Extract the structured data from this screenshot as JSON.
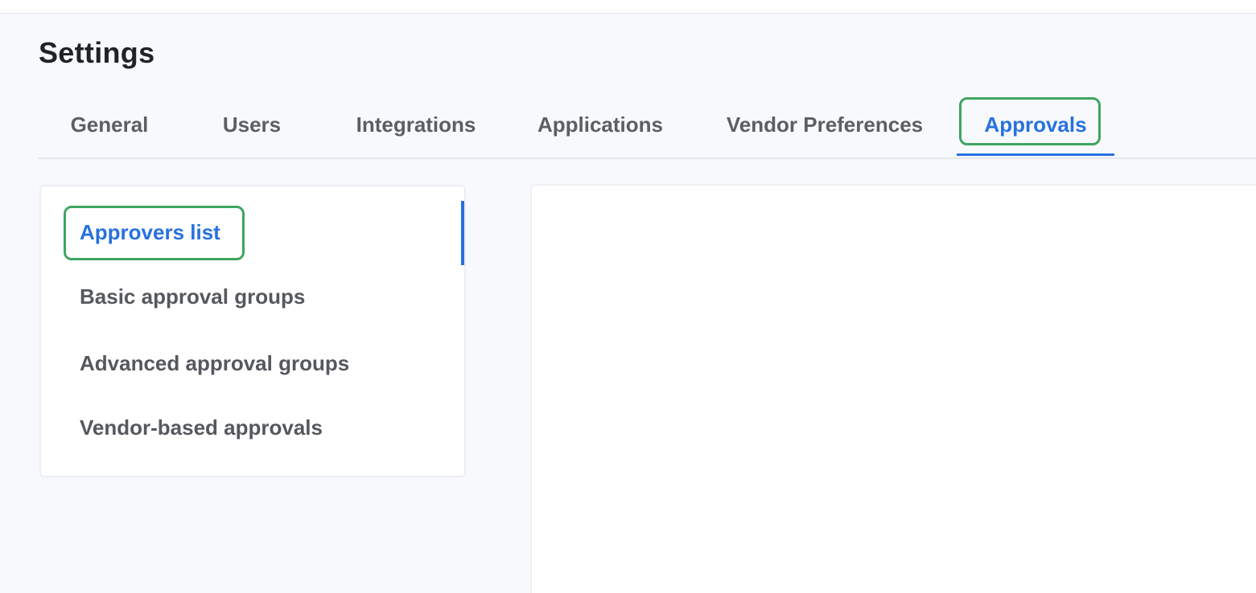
{
  "page": {
    "title": "Settings"
  },
  "tabs": [
    {
      "label": "General",
      "active": false
    },
    {
      "label": "Users",
      "active": false
    },
    {
      "label": "Integrations",
      "active": false
    },
    {
      "label": "Applications",
      "active": false
    },
    {
      "label": "Vendor Preferences",
      "active": false
    },
    {
      "label": "Approvals",
      "active": true
    }
  ],
  "approvals_menu": {
    "items": [
      {
        "label": "Approvers list",
        "active": true
      },
      {
        "label": "Basic approval groups",
        "active": false
      },
      {
        "label": "Advanced approval groups",
        "active": false
      },
      {
        "label": "Vendor-based approvals",
        "active": false
      }
    ]
  },
  "colors": {
    "accent": "#2771de",
    "highlight_outline": "#3fa560",
    "background": "#f8f9fc",
    "text_muted": "#5b5e63"
  }
}
